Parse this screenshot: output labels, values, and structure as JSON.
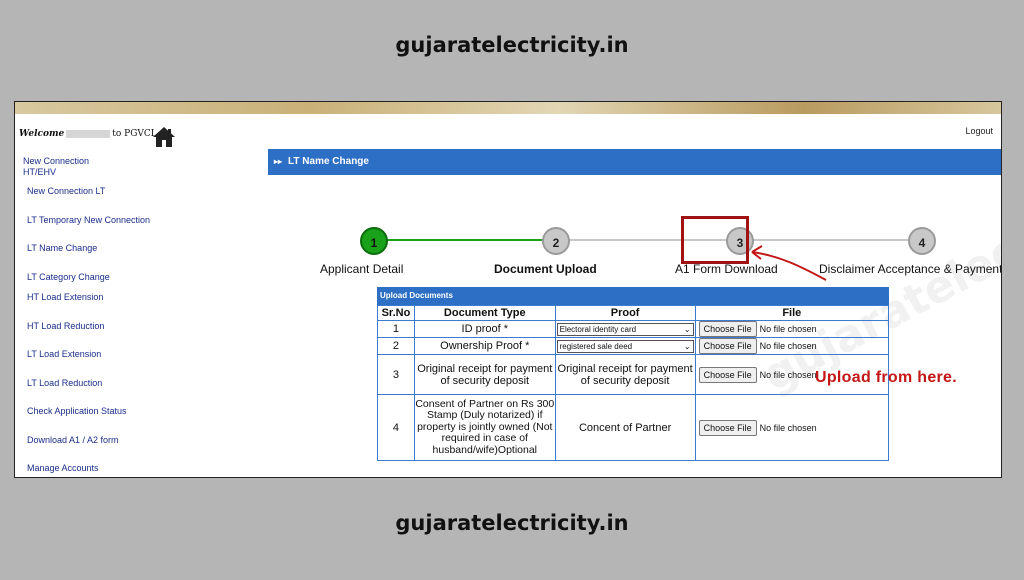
{
  "site": {
    "title_top": "gujaratelectricity.in",
    "title_bottom": "gujaratelectricity.in"
  },
  "header": {
    "welcome_prefix": "Welcome",
    "welcome_suffix": "to PGVCL",
    "logout": "Logout",
    "home_icon": "home-icon"
  },
  "sidebar": {
    "items": [
      "New Connection HT/EHV",
      "New Connection LT",
      "LT Temporary New Connection",
      "LT Name Change",
      "LT Category Change",
      "HT Load Extension",
      "HT Load Reduction",
      "LT Load Extension",
      "LT Load Reduction",
      "Check Application Status",
      "Download A1 / A2 form",
      "Manage Accounts"
    ]
  },
  "content": {
    "header": "LT Name Change",
    "watermark": "gujaratelectricity.in"
  },
  "steps": [
    {
      "number": "1",
      "label": "Applicant Detail",
      "state": "done"
    },
    {
      "number": "2",
      "label": "Document Upload",
      "state": "current"
    },
    {
      "number": "3",
      "label": "A1 Form Download",
      "state": "todo"
    },
    {
      "number": "4",
      "label": "Disclaimer Acceptance & Payment",
      "state": "todo"
    }
  ],
  "upload": {
    "caption": "Upload Documents",
    "columns": [
      "Sr.No",
      "Document Type",
      "Proof",
      "File"
    ],
    "choose_label": "Choose File",
    "no_file": "No file chosen",
    "rows": [
      {
        "sr": "1",
        "type": "ID proof *",
        "proof": "Electoral identity card",
        "proof_kind": "select"
      },
      {
        "sr": "2",
        "type": "Ownership Proof *",
        "proof": "registered sale deed",
        "proof_kind": "select"
      },
      {
        "sr": "3",
        "type": "Original receipt for payment of security deposit",
        "proof": "Original receipt for payment of security deposit",
        "proof_kind": "text"
      },
      {
        "sr": "4",
        "type": "Consent of Partner on Rs 300 Stamp (Duly notarized) if property is jointly owned (Not required in case of husband/wife)Optional",
        "proof": "Concent of Partner",
        "proof_kind": "text"
      }
    ]
  },
  "annotation": {
    "text": "Upload  from  here.",
    "color": "#c41717"
  }
}
